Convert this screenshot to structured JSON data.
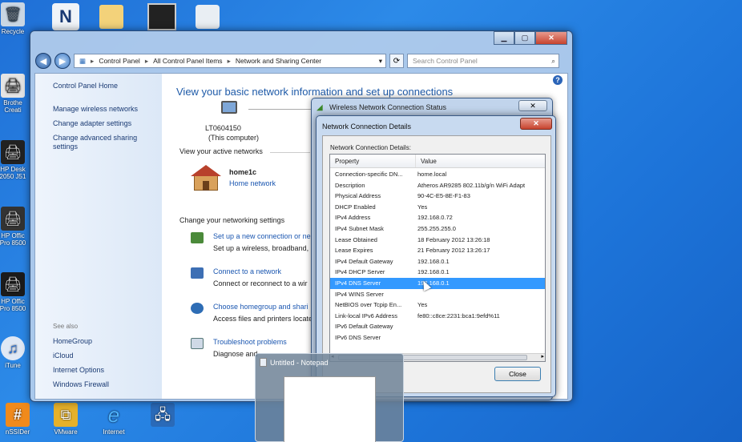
{
  "desktop": {
    "left_icons": [
      {
        "label": "Recycle",
        "icon": "recycle-bin-icon"
      },
      {
        "label": "Brothe Creati",
        "icon": "printer-icon"
      },
      {
        "label": "HP Desk 2050 J51",
        "icon": "printer-icon"
      },
      {
        "label": "HP Offic Pro 8500",
        "icon": "printer-icon"
      },
      {
        "label": "HP Offic Pro 8500",
        "icon": "printer-icon"
      },
      {
        "label": "iTune",
        "icon": "itunes-icon"
      },
      {
        "label": "nSSIDer",
        "icon": "app-icon"
      }
    ],
    "bottom_icons": [
      {
        "label": "VMware",
        "icon": "vmware-icon"
      },
      {
        "label": "Internet",
        "icon": "ie-icon"
      },
      {
        "label": "",
        "icon": "network-icon"
      }
    ]
  },
  "cp_window": {
    "breadcrumb": [
      "Control Panel",
      "All Control Panel Items",
      "Network and Sharing Center"
    ],
    "search_placeholder": "Search Control Panel",
    "left_links": [
      "Control Panel Home",
      "Manage wireless networks",
      "Change adapter settings",
      "Change advanced sharing settings"
    ],
    "see_also_label": "See also",
    "see_also": [
      "HomeGroup",
      "iCloud",
      "Internet Options",
      "Windows Firewall"
    ],
    "heading": "View your basic network information and set up connections",
    "computer_name": "LT0604150",
    "computer_sub": "(This computer)",
    "active_networks_label": "View your active networks",
    "network_name": "home1c",
    "network_type": "Home network",
    "change_settings_label": "Change your networking settings",
    "tasks": [
      {
        "link": "Set up a new connection or ne",
        "desc": "Set up a wireless, broadband,"
      },
      {
        "link": "Connect to a network",
        "desc": "Connect or reconnect to a wir"
      },
      {
        "link": "Choose homegroup and shari",
        "desc": "Access files and printers locate"
      },
      {
        "link": "Troubleshoot problems",
        "desc": "Diagnose and"
      }
    ]
  },
  "status_dialog": {
    "title": "Wireless Network Connection Status"
  },
  "details_dialog": {
    "title": "Network Connection Details",
    "group_label": "Network Connection Details:",
    "col_property": "Property",
    "col_value": "Value",
    "rows": [
      {
        "p": "Connection-specific DN...",
        "v": "home.local"
      },
      {
        "p": "Description",
        "v": "Atheros AR9285 802.11b/g/n WiFi Adapt"
      },
      {
        "p": "Physical Address",
        "v": "90-4C-E5-8E-F1-83"
      },
      {
        "p": "DHCP Enabled",
        "v": "Yes"
      },
      {
        "p": "IPv4 Address",
        "v": "192.168.0.72"
      },
      {
        "p": "IPv4 Subnet Mask",
        "v": "255.255.255.0"
      },
      {
        "p": "Lease Obtained",
        "v": "18 February 2012 13:26:18"
      },
      {
        "p": "Lease Expires",
        "v": "21 February 2012 13:26:17"
      },
      {
        "p": "IPv4 Default Gateway",
        "v": "192.168.0.1"
      },
      {
        "p": "IPv4 DHCP Server",
        "v": "192.168.0.1"
      },
      {
        "p": "IPv4 DNS Server",
        "v": "192.168.0.1"
      },
      {
        "p": "IPv4 WINS Server",
        "v": ""
      },
      {
        "p": "NetBIOS over Tcpip En...",
        "v": "Yes"
      },
      {
        "p": "Link-local IPv6 Address",
        "v": "fe80::c8ce:2231:bca1:9efd%11"
      },
      {
        "p": "IPv6 Default Gateway",
        "v": ""
      },
      {
        "p": "IPv6 DNS Server",
        "v": ""
      }
    ],
    "selected_row": 10,
    "close_label": "Close"
  },
  "notepad_thumb": {
    "title": "Untitled - Notepad"
  }
}
